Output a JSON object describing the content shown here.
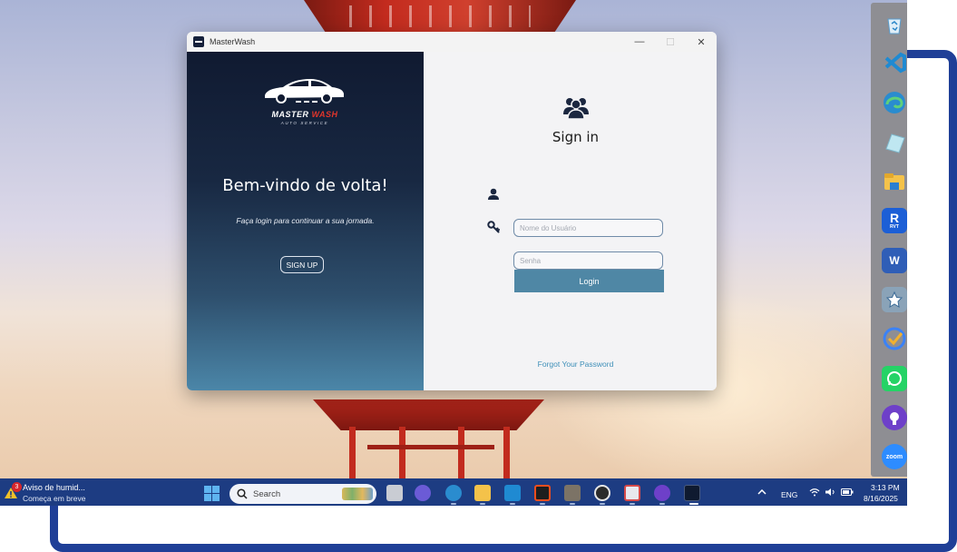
{
  "window": {
    "title": "MasterWash",
    "minimize_glyph": "—",
    "maximize_glyph": "☐",
    "close_glyph": "✕"
  },
  "brand": {
    "name_part1": "MASTER",
    "name_part2": "WASH",
    "tagline": "AUTO SERVICE"
  },
  "left_panel": {
    "welcome_title": "Bem-vindo de volta!",
    "welcome_subtitle": "Faça login para continuar a sua jornada.",
    "signup_label": "SIGN UP"
  },
  "right_panel": {
    "title": "Sign in",
    "username_placeholder": "Nome do Usuário",
    "password_placeholder": "Senha",
    "login_label": "Login",
    "forgot_label": "Forgot Your Password"
  },
  "taskbar": {
    "weather_badge": "3",
    "weather_title": "Aviso de humid...",
    "weather_subtitle": "Começa em breve",
    "search_label": "Search",
    "language": "ENG",
    "time": "3:13 PM",
    "date": "8/16/2025"
  },
  "dock": {
    "rvt_letter": "R",
    "rvt_label": "RVT",
    "word_letter": "W",
    "zoom_label": "zoom"
  },
  "colors": {
    "accent": "#4f87a5",
    "taskbar": "#1d3c82",
    "frame": "#1f3f97",
    "brand_red": "#e0352b"
  }
}
